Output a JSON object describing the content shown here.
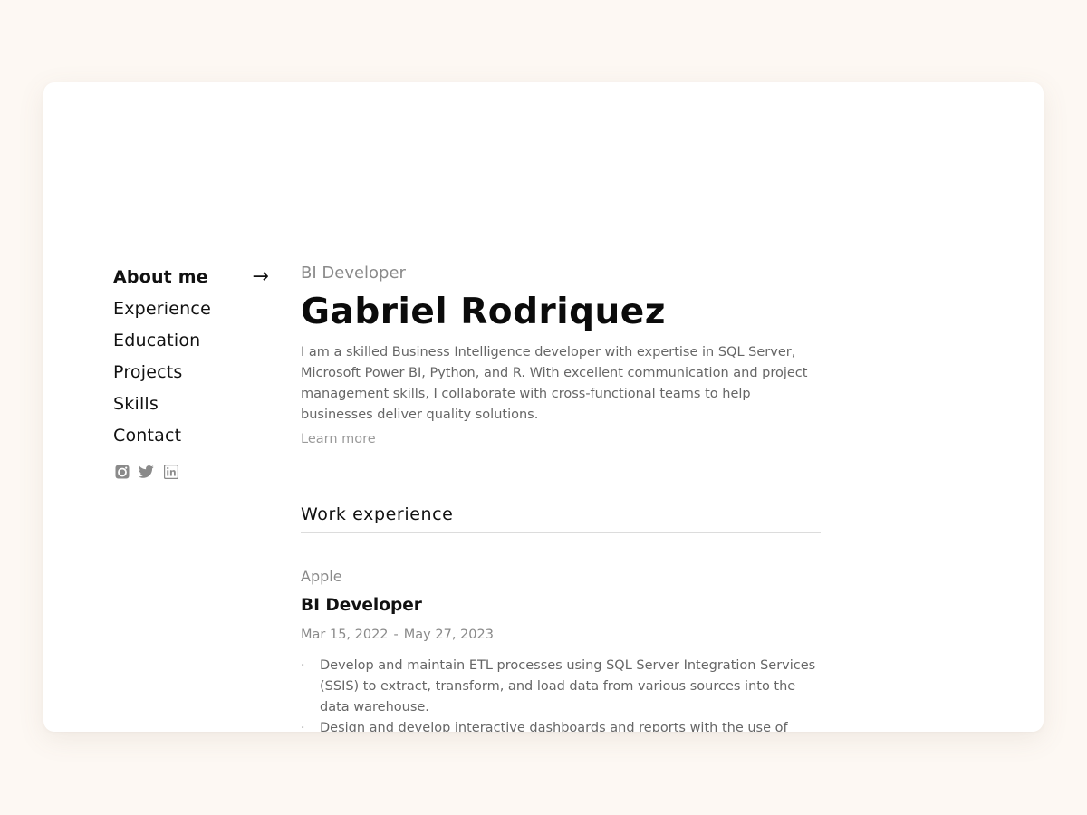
{
  "nav": {
    "items": [
      {
        "label": "About me",
        "active": true,
        "arrow": "→"
      },
      {
        "label": "Experience",
        "active": false
      },
      {
        "label": "Education",
        "active": false
      },
      {
        "label": "Projects",
        "active": false
      },
      {
        "label": "Skills",
        "active": false
      },
      {
        "label": "Contact",
        "active": false
      }
    ],
    "social": [
      "instagram-icon",
      "twitter-icon",
      "linkedin-icon"
    ]
  },
  "profile": {
    "role": "BI Developer",
    "name": "Gabriel Rodriquez",
    "bio": "I am a skilled Business Intelligence developer with expertise in SQL Server, Microsoft Power BI, Python, and R. With excellent communication and project management skills, I collaborate with cross-functional teams to help businesses deliver quality solutions.",
    "learn_more": "Learn more"
  },
  "work": {
    "title": "Work experience",
    "jobs": [
      {
        "company": "Apple",
        "title": "BI Developer",
        "start": "Mar 15, 2022",
        "separator": "-",
        "end": "May 27, 2023",
        "bullets": [
          "Develop and maintain ETL processes using SQL Server Integration Services (SSIS) to extract, transform, and load data from various sources into the data warehouse.",
          "Design and develop interactive dashboards and reports with the use of Power BI."
        ]
      }
    ]
  },
  "colors": {
    "page_background": "#fdf8f3",
    "card_background": "#ffffff",
    "primary_text": "#111111",
    "muted_text": "#8a8a8a",
    "body_text": "#666666",
    "icon_color": "#8a8a8a",
    "divider": "#dcdcdc"
  }
}
